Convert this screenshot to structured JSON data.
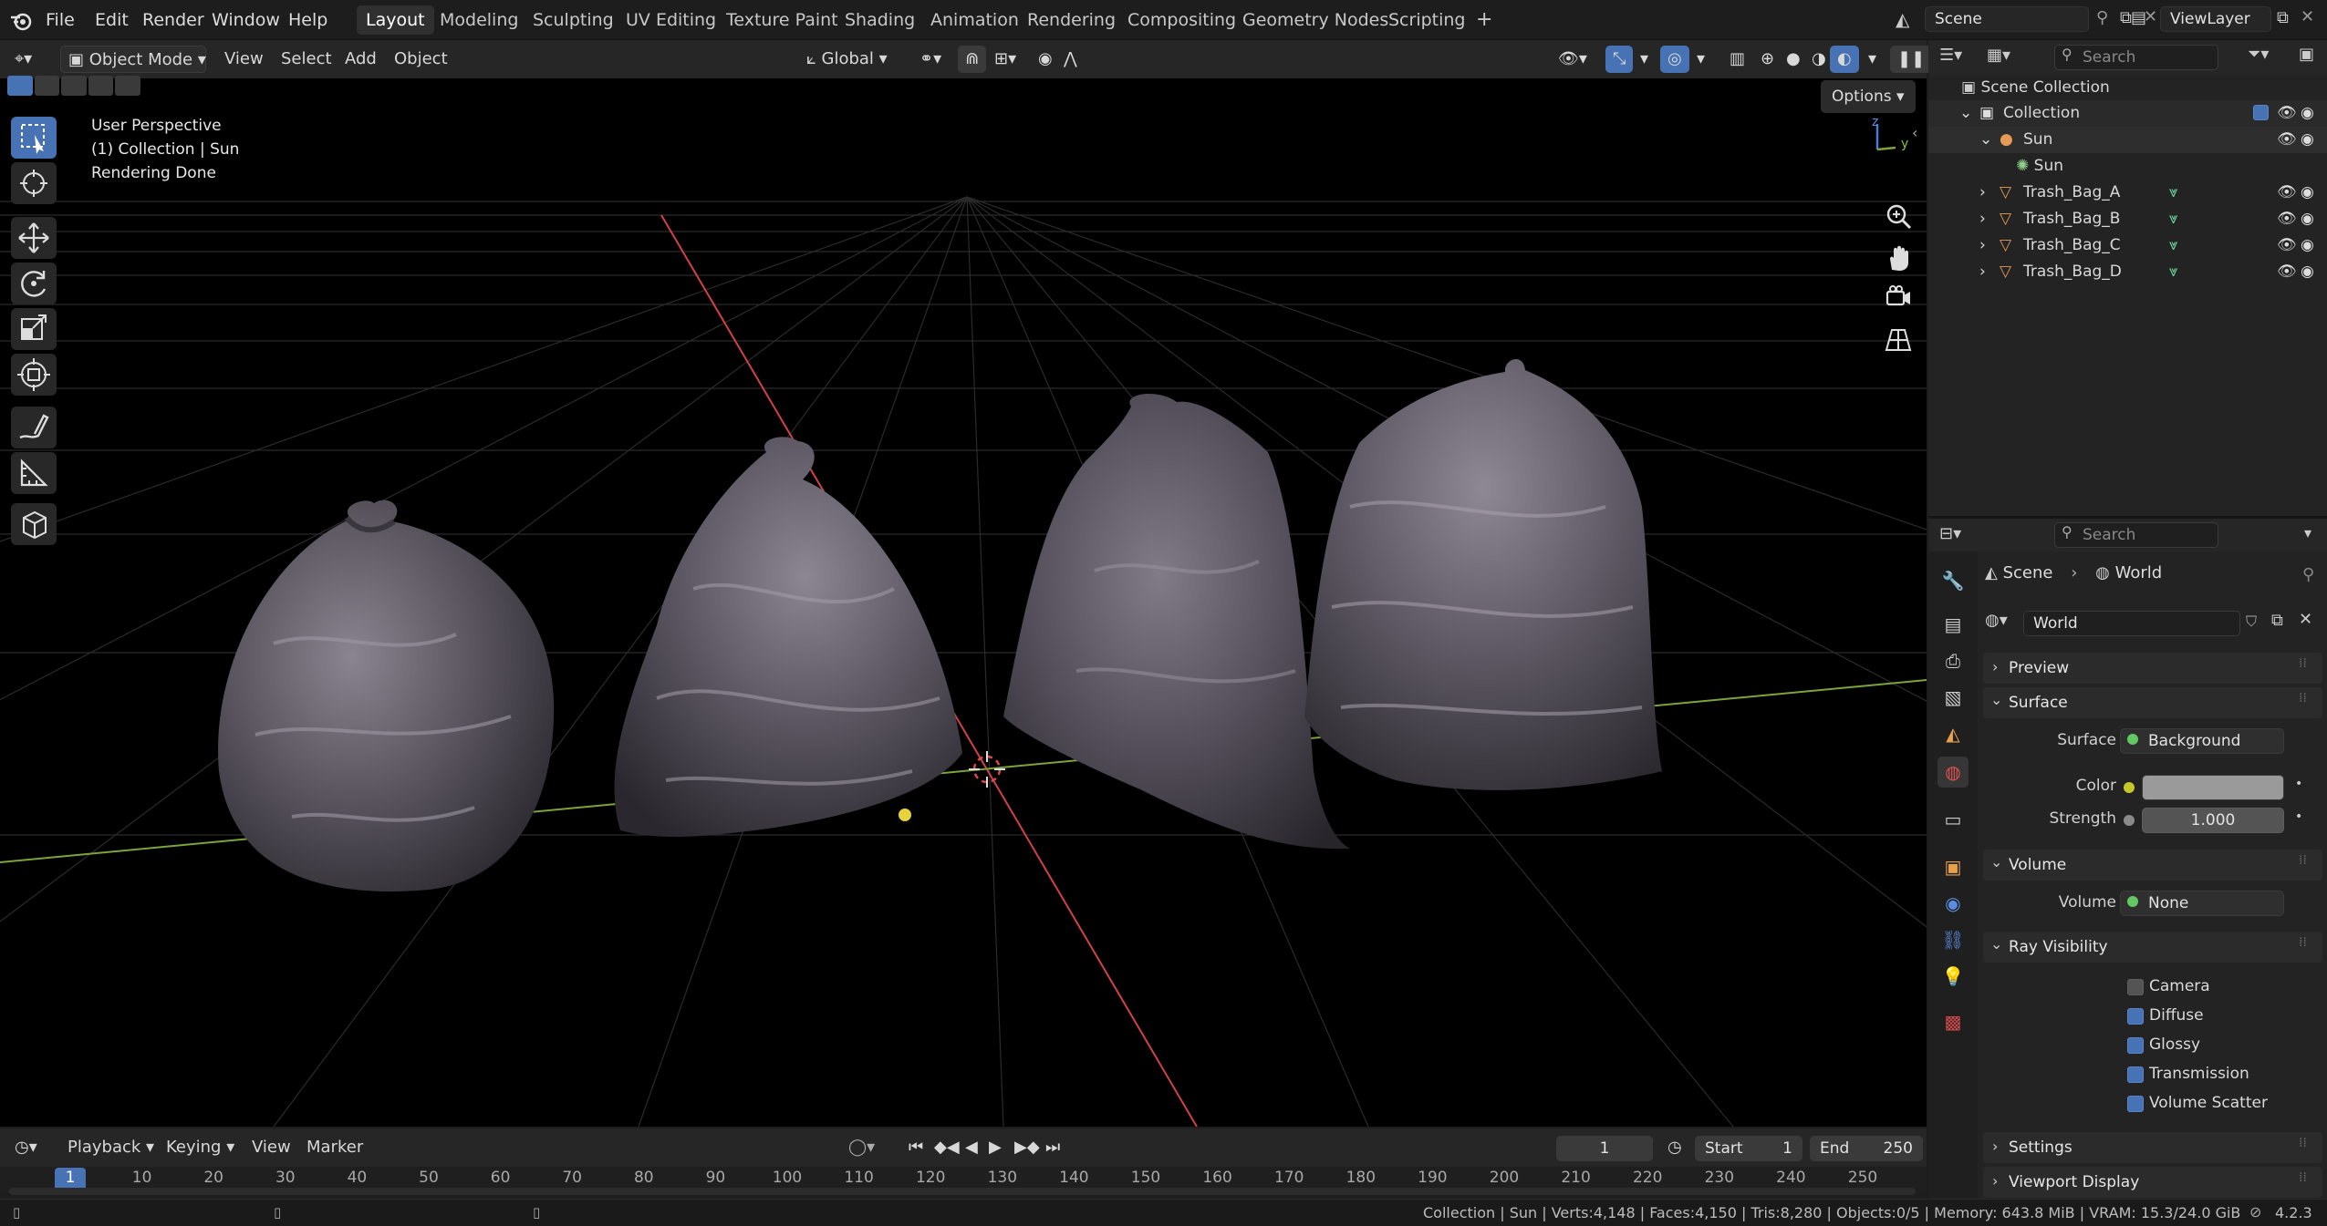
{
  "menubar": {
    "items": [
      "File",
      "Edit",
      "Render",
      "Window",
      "Help"
    ],
    "workspaces": [
      "Layout",
      "Modeling",
      "Sculpting",
      "UV Editing",
      "Texture Paint",
      "Shading",
      "Animation",
      "Rendering",
      "Compositing",
      "Geometry Nodes",
      "Scripting"
    ],
    "active_workspace": "Layout",
    "scene": "Scene",
    "view_layer": "ViewLayer"
  },
  "header3d": {
    "mode": "Object Mode",
    "menus": [
      "View",
      "Select",
      "Add",
      "Object"
    ],
    "orientation": "Global",
    "options": "Options"
  },
  "overlay": {
    "line1": "User Perspective",
    "line2": "(1) Collection | Sun",
    "line3": "Rendering Done",
    "axis_z": "z",
    "axis_y": "y"
  },
  "outliner": {
    "search_placeholder": "Search",
    "scene_collection": "Scene Collection",
    "collection": "Collection",
    "sun_object": "Sun",
    "sun_data": "Sun",
    "objects": [
      "Trash_Bag_A",
      "Trash_Bag_B",
      "Trash_Bag_C",
      "Trash_Bag_D"
    ]
  },
  "properties": {
    "search_placeholder": "Search",
    "breadcrumb_scene": "Scene",
    "breadcrumb_world": "World",
    "world_name": "World",
    "preview": "Preview",
    "surface_panel": "Surface",
    "surface_label": "Surface",
    "surface_value": "Background",
    "color_label": "Color",
    "color_value": "#9a9a9a",
    "strength_label": "Strength",
    "strength_value": "1.000",
    "volume_panel": "Volume",
    "volume_label": "Volume",
    "volume_value": "None",
    "ray_panel": "Ray Visibility",
    "ray_items": [
      {
        "label": "Camera",
        "checked": false
      },
      {
        "label": "Diffuse",
        "checked": true
      },
      {
        "label": "Glossy",
        "checked": true
      },
      {
        "label": "Transmission",
        "checked": true
      },
      {
        "label": "Volume Scatter",
        "checked": true
      }
    ],
    "settings_panel": "Settings",
    "viewport_display_panel": "Viewport Display"
  },
  "timeline": {
    "menus": [
      "Playback",
      "Keying",
      "View",
      "Marker"
    ],
    "current_frame": "1",
    "start_label": "Start",
    "start_value": "1",
    "end_label": "End",
    "end_value": "250",
    "ticks": [
      "1",
      "10",
      "20",
      "30",
      "40",
      "50",
      "60",
      "70",
      "80",
      "90",
      "100",
      "110",
      "120",
      "130",
      "140",
      "150",
      "160",
      "170",
      "180",
      "190",
      "200",
      "210",
      "220",
      "230",
      "240",
      "250"
    ]
  },
  "statusbar": {
    "text": "Collection | Sun | Verts:4,148 | Faces:4,150 | Tris:8,280 | Objects:0/5 | Memory: 643.8 MiB | VRAM: 15.3/24.0 GiB",
    "version": "4.2.3"
  },
  "colors": {
    "accent": "#4772b3",
    "selected_tab": "#303030",
    "x_axis": "#d2404a",
    "y_axis": "#7ea33a",
    "sun_light": "#e6d23a"
  }
}
